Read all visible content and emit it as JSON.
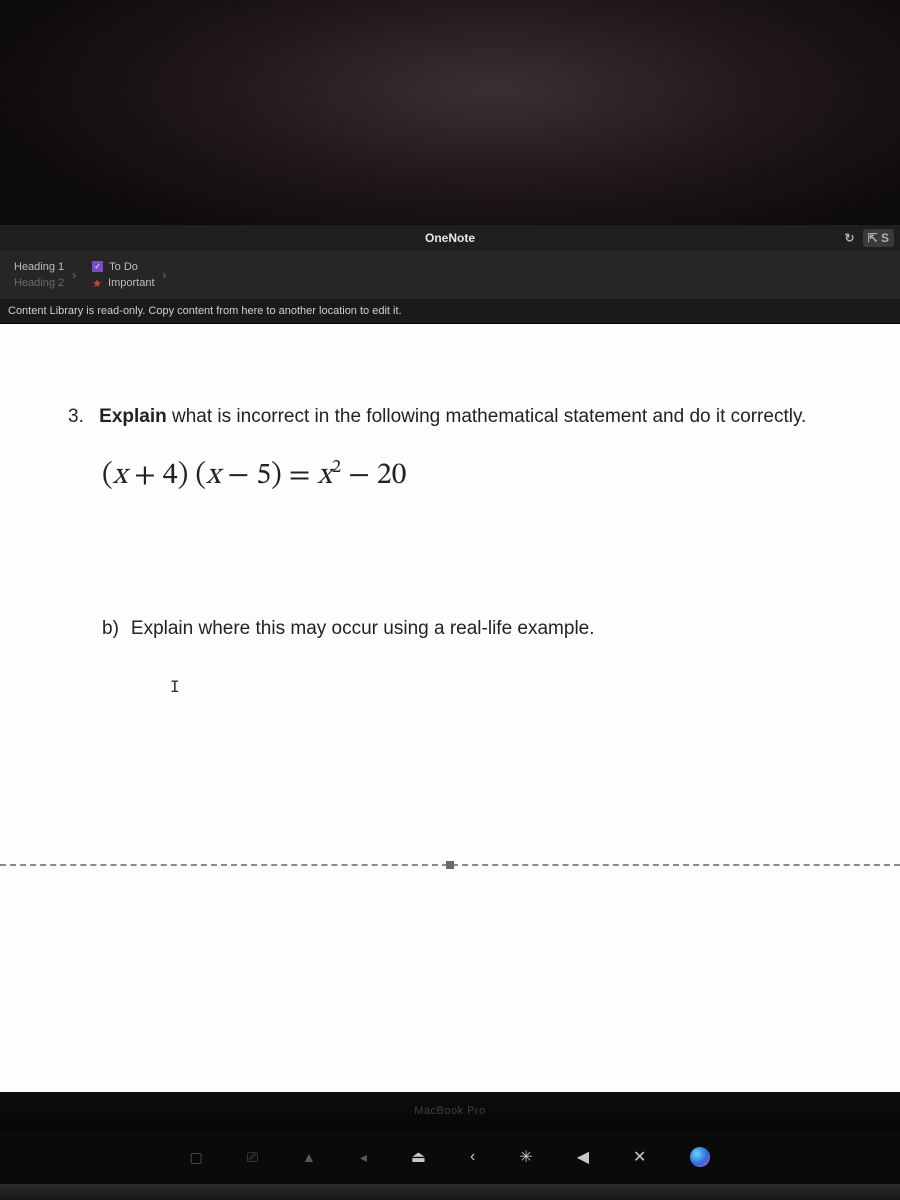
{
  "app": {
    "title": "OneNote",
    "share_label": "S"
  },
  "ribbon": {
    "heading1": "Heading 1",
    "heading2": "Heading 2",
    "todo": "To Do",
    "important": "Important"
  },
  "banner": {
    "text": "Content Library is read-only. Copy content from here to another location to edit it."
  },
  "doc": {
    "q3_number": "3.",
    "q3_lead": "Explain",
    "q3_rest": " what is incorrect in the following mathematical statement and do it correctly.",
    "eq_lp": "(",
    "eq_x1": "x",
    "eq_plus": " + 4) (",
    "eq_x2": "x",
    "eq_minus5": " − 5) = ",
    "eq_x3": "x",
    "eq_sq": "2",
    "eq_minus20": " − 20",
    "qb_number": "b)",
    "qb_text": "Explain where this may occur using a real-life example.",
    "cursor_glyph": "I"
  },
  "bezel": {
    "brand": "MacBook Pro"
  },
  "fnrow": {
    "k1": "▢",
    "k2": "⎚",
    "k3": "▲",
    "k4": "◂",
    "k5": "⏏",
    "k6": "‹",
    "k7": "✳",
    "k8": "◀",
    "k9": "✕"
  }
}
